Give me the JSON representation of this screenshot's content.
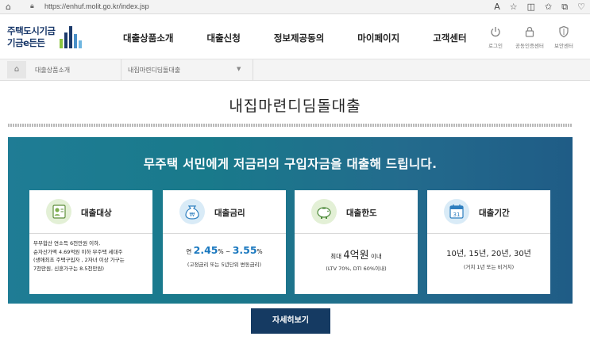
{
  "browser": {
    "url": "https://enhuf.molit.go.kr/index.jsp"
  },
  "logo": {
    "line1": "주택도시기금",
    "line2": "기금e든든"
  },
  "nav": [
    "대출상품소개",
    "대출신청",
    "정보제공동의",
    "마이페이지",
    "고객센터"
  ],
  "utility": [
    {
      "label": "로그인",
      "icon": "power-icon"
    },
    {
      "label": "공동인증센터",
      "icon": "lock-icon"
    },
    {
      "label": "보안센터",
      "icon": "shield-icon"
    }
  ],
  "breadcrumb": {
    "level1": "대출상품소개",
    "level2": "내집마련디딤돌대출"
  },
  "page_title": "내집마련디딤돌대출",
  "banner": {
    "headline": "무주택 서민에게 저금리의 구입자금을 대출해 드립니다.",
    "cards": [
      {
        "title": "대출대상",
        "icon": "person-id-icon",
        "lines": [
          "부부합산 연소득 6천만원 이하,",
          "순자산가액 4.69억원 이하 무주택 세대주",
          "(생애최초 주택구입자 , 2자녀 이상 가구는",
          "7천만원, 신혼가구는 8.5천만원)"
        ]
      },
      {
        "title": "대출금리",
        "icon": "money-bag-icon",
        "prefix": "연",
        "rate_low": "2.45",
        "pct": "%",
        "tilde": "~",
        "rate_high": "3.55",
        "note": "(고정금리 또는 5년단위 변동금리)"
      },
      {
        "title": "대출한도",
        "icon": "piggy-bank-icon",
        "prefix": "최대",
        "amount": "4억원",
        "suffix": "이내",
        "note": "(LTV 70%, DTI 60%이내)"
      },
      {
        "title": "대출기간",
        "icon": "calendar-icon",
        "calendar_day": "31",
        "terms": "10년, 15년, 20년, 30년",
        "note": "(거치 1년 또는 비거치)"
      }
    ]
  },
  "more_button": "자세히보기",
  "colors": {
    "banner": "#1f7c95",
    "accent_blue": "#1a78bf",
    "button": "#153a62",
    "logo_text": "#1b3a6b"
  }
}
